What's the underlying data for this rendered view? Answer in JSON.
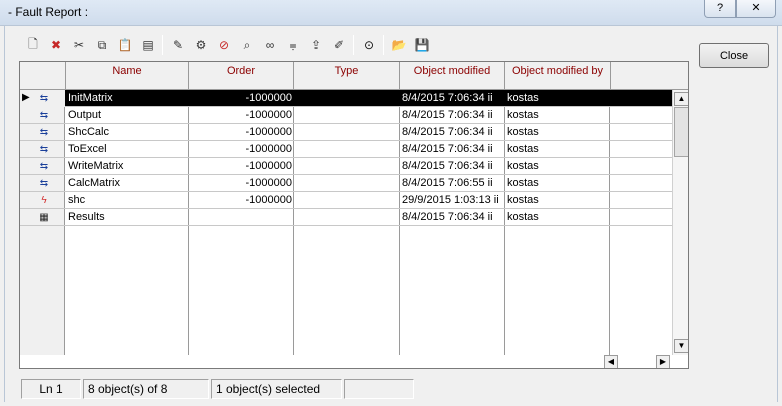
{
  "window": {
    "title": "- Fault Report :",
    "help_label": "?",
    "close_glyph": "✕"
  },
  "toolbar": {
    "groups": [
      [
        "new-icon",
        "delete-icon",
        "cut-icon",
        "copy-icon",
        "paste-icon",
        "paste-special-icon"
      ],
      [
        "edit-icon",
        "settings-icon",
        "forbidden-icon",
        "inspect-icon",
        "glasses-icon",
        "filter-icon",
        "export-icon",
        "edit-window-icon"
      ],
      [
        "find-icon"
      ],
      [
        "open-icon",
        "save-icon"
      ]
    ]
  },
  "close_button": {
    "label": "Close"
  },
  "table": {
    "columns": [
      "Name",
      "Order",
      "Type",
      "Object modified",
      "Object modified by"
    ],
    "rows": [
      {
        "icon": "script-icon",
        "name": "InitMatrix",
        "order": "-1000000",
        "type": "",
        "modified": "8/4/2015 7:06:34 ii",
        "modified_by": "kostas",
        "selected": true
      },
      {
        "icon": "script-icon",
        "name": "Output",
        "order": "-1000000",
        "type": "",
        "modified": "8/4/2015 7:06:34 ii",
        "modified_by": "kostas",
        "selected": false
      },
      {
        "icon": "script-icon",
        "name": "ShcCalc",
        "order": "-1000000",
        "type": "",
        "modified": "8/4/2015 7:06:34 ii",
        "modified_by": "kostas",
        "selected": false
      },
      {
        "icon": "script-icon",
        "name": "ToExcel",
        "order": "-1000000",
        "type": "",
        "modified": "8/4/2015 7:06:34 ii",
        "modified_by": "kostas",
        "selected": false
      },
      {
        "icon": "script-icon",
        "name": "WriteMatrix",
        "order": "-1000000",
        "type": "",
        "modified": "8/4/2015 7:06:34 ii",
        "modified_by": "kostas",
        "selected": false
      },
      {
        "icon": "script-icon",
        "name": "CalcMatrix",
        "order": "-1000000",
        "type": "",
        "modified": "8/4/2015 7:06:55 ii",
        "modified_by": "kostas",
        "selected": false
      },
      {
        "icon": "shortcircuit-icon",
        "name": "shc",
        "order": "-1000000",
        "type": "",
        "modified": "29/9/2015 1:03:13 ii",
        "modified_by": "kostas",
        "selected": false
      },
      {
        "icon": "table-icon",
        "name": "Results",
        "order": "",
        "type": "",
        "modified": "8/4/2015 7:06:34 ii",
        "modified_by": "kostas",
        "selected": false
      }
    ]
  },
  "status": {
    "line": "Ln 1",
    "objects": "8 object(s) of 8",
    "selected": "1 object(s) selected",
    "extra": ""
  }
}
